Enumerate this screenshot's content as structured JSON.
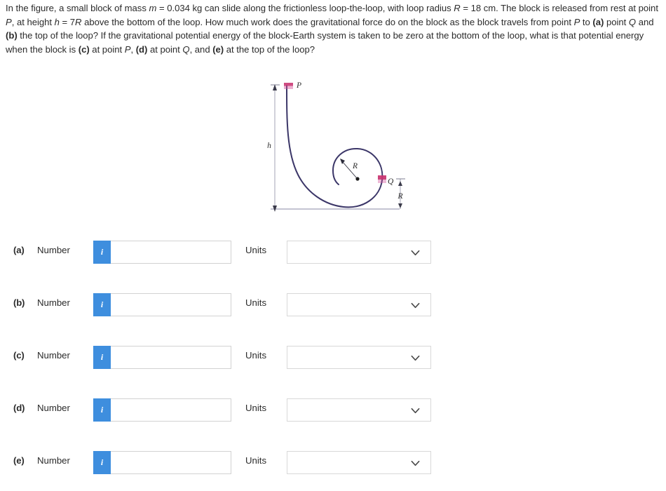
{
  "problem": {
    "segments": [
      {
        "t": "In the figure, a small block of mass ",
        "s": "n"
      },
      {
        "t": "m",
        "s": "i"
      },
      {
        "t": " = 0.034 kg can slide along the frictionless loop-the-loop, with loop radius ",
        "s": "n"
      },
      {
        "t": "R",
        "s": "i"
      },
      {
        "t": " = 18 cm. The block is released from rest at point ",
        "s": "n"
      },
      {
        "t": "P",
        "s": "i"
      },
      {
        "t": ", at height ",
        "s": "n"
      },
      {
        "t": "h",
        "s": "i"
      },
      {
        "t": " = 7",
        "s": "n"
      },
      {
        "t": "R",
        "s": "i"
      },
      {
        "t": " above the bottom of the loop. How much work does the gravitational force do on the block as the block travels from point ",
        "s": "n"
      },
      {
        "t": "P",
        "s": "i"
      },
      {
        "t": " to ",
        "s": "n"
      },
      {
        "t": "(a)",
        "s": "b"
      },
      {
        "t": " point ",
        "s": "n"
      },
      {
        "t": "Q",
        "s": "i"
      },
      {
        "t": " and ",
        "s": "n"
      },
      {
        "t": "(b)",
        "s": "b"
      },
      {
        "t": " the top of the loop? If the gravitational potential energy of the block-Earth system is taken to be zero at the bottom of the loop, what is that potential energy when the block is ",
        "s": "n"
      },
      {
        "t": "(c)",
        "s": "b"
      },
      {
        "t": " at point ",
        "s": "n"
      },
      {
        "t": "P",
        "s": "i"
      },
      {
        "t": ", ",
        "s": "n"
      },
      {
        "t": "(d)",
        "s": "b"
      },
      {
        "t": " at point ",
        "s": "n"
      },
      {
        "t": "Q",
        "s": "i"
      },
      {
        "t": ", and ",
        "s": "n"
      },
      {
        "t": "(e)",
        "s": "b"
      },
      {
        "t": " at the top of the loop?",
        "s": "n"
      }
    ],
    "mass_value": "0.034 kg",
    "radius_value": "18 cm",
    "height_value": "7R"
  },
  "figure": {
    "label_P": "P",
    "label_Q": "Q",
    "label_h": "h",
    "label_R_radius": "R",
    "label_R_height": "R",
    "curve_color": "#3b3668",
    "block_color": "#c8336e",
    "ground_color": "#7a7a9a",
    "dimension_color": "#6f6f86"
  },
  "rows": [
    {
      "letter": "(a)",
      "number_label": "Number",
      "info_glyph": "i",
      "number_value": "",
      "number_placeholder": "",
      "units_label": "Units",
      "units_value": "",
      "units_placeholder": ""
    },
    {
      "letter": "(b)",
      "number_label": "Number",
      "info_glyph": "i",
      "number_value": "",
      "number_placeholder": "",
      "units_label": "Units",
      "units_value": "",
      "units_placeholder": ""
    },
    {
      "letter": "(c)",
      "number_label": "Number",
      "info_glyph": "i",
      "number_value": "",
      "number_placeholder": "",
      "units_label": "Units",
      "units_value": "",
      "units_placeholder": ""
    },
    {
      "letter": "(d)",
      "number_label": "Number",
      "info_glyph": "i",
      "number_value": "",
      "number_placeholder": "",
      "units_label": "Units",
      "units_value": "",
      "units_placeholder": ""
    },
    {
      "letter": "(e)",
      "number_label": "Number",
      "info_glyph": "i",
      "number_value": "",
      "number_placeholder": "",
      "units_label": "Units",
      "units_value": "",
      "units_placeholder": ""
    }
  ],
  "colors": {
    "info_button": "#3e8ede",
    "text": "#2b2b2b",
    "input_border": "#d2d2d2"
  }
}
